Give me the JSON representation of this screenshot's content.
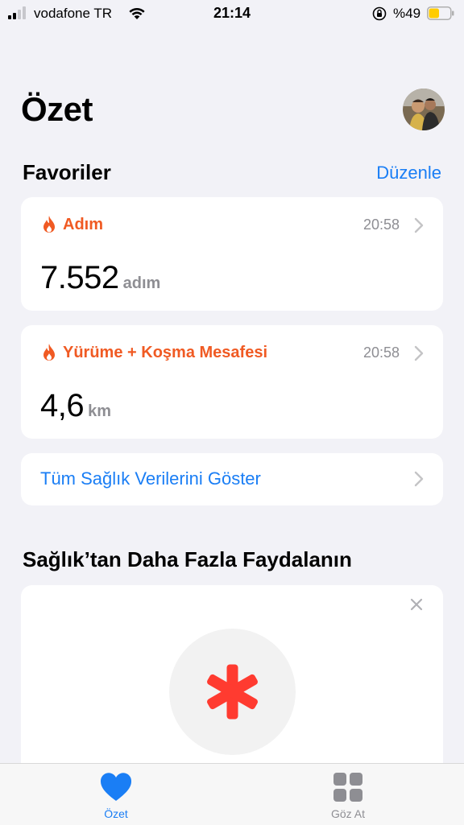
{
  "status_bar": {
    "carrier": "vodafone TR",
    "time": "21:14",
    "battery_percent": "%49",
    "battery_level": 0.49,
    "icons": [
      "signal-icon",
      "wifi-icon",
      "rotation-lock-icon",
      "battery-icon"
    ]
  },
  "header": {
    "title": "Özet"
  },
  "favorites": {
    "title": "Favoriler",
    "edit_label": "Düzenle",
    "items": [
      {
        "name": "Adım",
        "time": "20:58",
        "value": "7.552",
        "unit": "adım",
        "icon": "flame-icon"
      },
      {
        "name": "Yürüme + Koşma Mesafesi",
        "time": "20:58",
        "value": "4,6",
        "unit": "km",
        "icon": "flame-icon"
      }
    ],
    "show_all_label": "Tüm Sağlık Verilerini Göster"
  },
  "more": {
    "title": "Sağlık’tan Daha Fazla Faydalanın",
    "icon": "health-asterisk-icon"
  },
  "tab_bar": {
    "tabs": [
      {
        "label": "Özet",
        "icon": "heart-icon",
        "active": true
      },
      {
        "label": "Göz At",
        "icon": "grid-icon",
        "active": false
      }
    ]
  },
  "colors": {
    "accent": "#1a7ef5",
    "metric": "#f05a23",
    "health_red": "#ff3b30",
    "background": "#f2f2f7"
  }
}
